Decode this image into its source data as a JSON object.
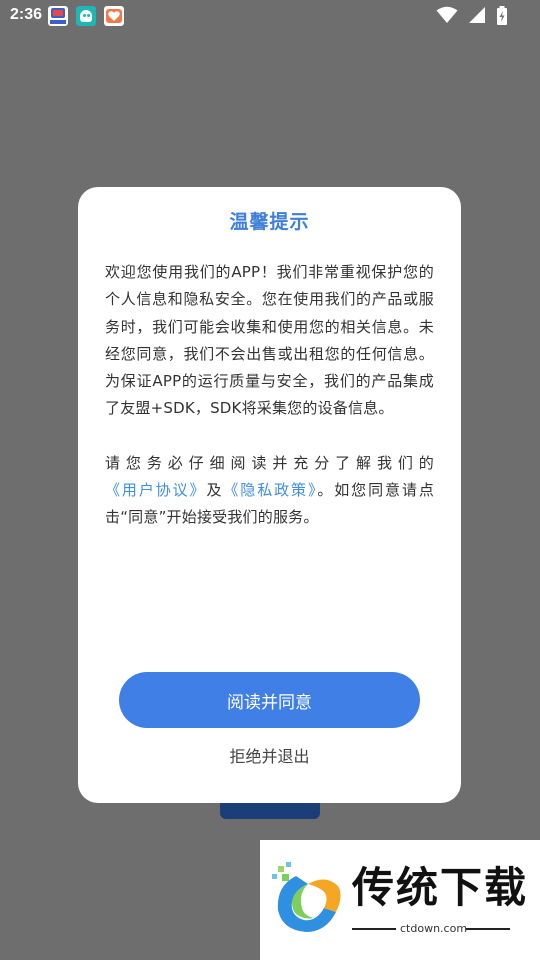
{
  "status_bar": {
    "time": "2:36",
    "icons": [
      "app-notification-icon",
      "game-notification-icon",
      "health-notification-icon",
      "wifi-icon",
      "signal-icon",
      "battery-icon"
    ]
  },
  "dialog": {
    "title": "温馨提示",
    "paragraph1": "欢迎您使用我们的APP！我们非常重视保护您的个人信息和隐私安全。您在使用我们的产品或服务时，我们可能会收集和使用您的相关信息。未经您同意，我们不会出售或出租您的任何信息。为保证APP的运行质量与安全，我们的产品集成了友盟+SDK，SDK将采集您的设备信息。",
    "paragraph2_part1": "请您务必仔细阅读并充分了解我们的",
    "user_agreement_link": "《用户协议》",
    "paragraph2_and": "及",
    "privacy_policy_link": "《隐私政策》",
    "paragraph2_part2": "。如您同意请点击“同意”开始接受我们的服务。",
    "agree_label": "阅读并同意",
    "reject_label": "拒绝并退出"
  },
  "watermark": {
    "brand": "传统下载",
    "url": "ctdown.com"
  },
  "colors": {
    "accent": "#3f7fe6",
    "title": "#3f7fd9",
    "link": "#3f8ee6",
    "overlay": "#6e6e6e"
  }
}
